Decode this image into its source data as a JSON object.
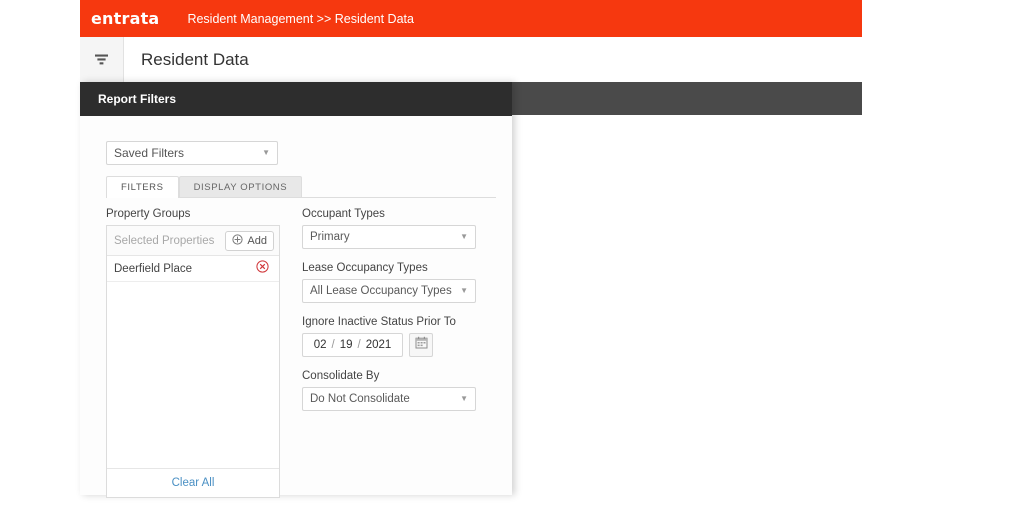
{
  "brand": {
    "logo_text": "entrata",
    "breadcrumb": "Resident Management >> Resident Data",
    "accent_color": "#f6380f"
  },
  "titlebar": {
    "filter_toggle_icon": "filter-icon",
    "page_title": "Resident Data"
  },
  "panel": {
    "header_title": "Report Filters",
    "saved_filters": {
      "label": "Saved Filters",
      "value": "Saved Filters"
    },
    "tabs": [
      {
        "label": "FILTERS",
        "active": true
      },
      {
        "label": "DISPLAY OPTIONS",
        "active": false
      }
    ],
    "property_groups": {
      "label": "Property Groups",
      "search_placeholder": "Selected Properties",
      "add_button_label": "Add",
      "items": [
        {
          "name": "Deerfield Place"
        }
      ],
      "clear_all_label": "Clear All"
    },
    "occupant_types": {
      "label": "Occupant Types",
      "value": "Primary"
    },
    "lease_occupancy_types": {
      "label": "Lease Occupancy Types",
      "value": "All Lease Occupancy Types"
    },
    "ignore_inactive": {
      "label": "Ignore Inactive Status Prior To",
      "month": "02",
      "day": "19",
      "year": "2021",
      "separator": "/",
      "calendar_icon": "calendar-icon"
    },
    "consolidate_by": {
      "label": "Consolidate By",
      "value": "Do Not Consolidate"
    }
  }
}
